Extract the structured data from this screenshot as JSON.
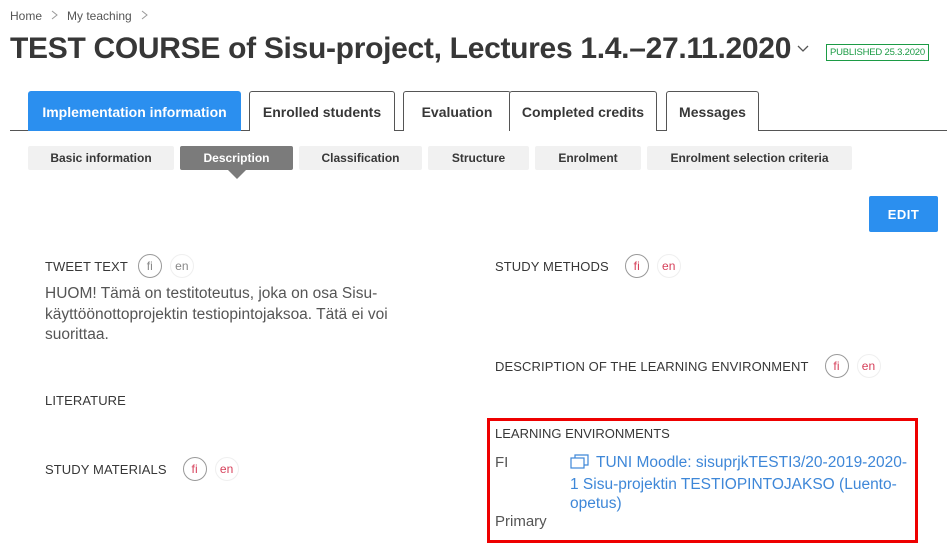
{
  "breadcrumb": {
    "items": [
      "Home",
      "My teaching"
    ],
    "separator": ">"
  },
  "header": {
    "title": "TEST COURSE of Sisu-project, Lectures 1.4.–27.11.2020",
    "status_badge": "PUBLISHED 25.3.2020",
    "status_color": "#1c9b45"
  },
  "main_tabs": [
    {
      "label": "Implementation information",
      "active": true
    },
    {
      "label": "Enrolled students",
      "active": false
    },
    {
      "label": "Evaluation",
      "active": false
    },
    {
      "label": "Completed credits",
      "active": false
    },
    {
      "label": "Messages",
      "active": false
    }
  ],
  "sub_tabs": [
    {
      "label": "Basic information",
      "active": false
    },
    {
      "label": "Description",
      "active": true
    },
    {
      "label": "Classification",
      "active": false
    },
    {
      "label": "Structure",
      "active": false
    },
    {
      "label": "Enrolment",
      "active": false
    },
    {
      "label": "Enrolment selection criteria",
      "active": false
    }
  ],
  "actions": {
    "edit_label": "EDIT"
  },
  "colors": {
    "accent": "#2b8fef",
    "highlight": "#ee0000",
    "missing_language": "#d6405a",
    "link": "#3e87d8"
  },
  "fields": {
    "tweet_text": {
      "label": "TWEET TEXT",
      "languages": [
        "fi",
        "en"
      ],
      "value": "HUOM! Tämä on testitoteutus, joka on osa Sisu-käyttöönottoprojektin testiopintojaksoa. Tätä ei voi suorittaa."
    },
    "literature": {
      "label": "LITERATURE"
    },
    "study_materials": {
      "label": "STUDY MATERIALS",
      "languages": [
        "fi",
        "en"
      ]
    },
    "study_methods": {
      "label": "STUDY METHODS",
      "languages": [
        "fi",
        "en"
      ]
    },
    "learning_environment_description": {
      "label": "DESCRIPTION OF THE LEARNING ENVIRONMENT",
      "languages": [
        "fi",
        "en"
      ]
    },
    "learning_environments": {
      "label": "LEARNING ENVIRONMENTS",
      "items": [
        {
          "language": "FI",
          "link_text": "TUNI Moodle: sisuprjkTESTI3/20-2019-2020-1 Sisu-projektin TESTIOPINTOJAKSO (Luento-opetus)",
          "primary_label": "Primary",
          "icon": "external-link-icon"
        }
      ]
    }
  }
}
